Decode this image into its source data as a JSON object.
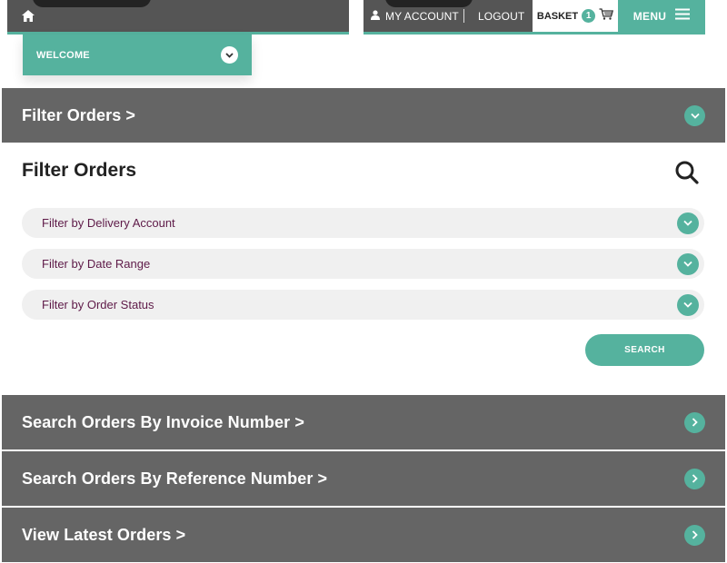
{
  "topnav": {
    "my_account": "MY ACCOUNT",
    "logout": "LOGOUT",
    "basket_label": "BASKET",
    "basket_count": "1",
    "menu_label": "MENU"
  },
  "welcome": {
    "label": "WELCOME"
  },
  "sections": {
    "filter_orders_bar": "Filter Orders >",
    "invoice_bar": "Search Orders By Invoice Number >",
    "reference_bar": "Search Orders By Reference Number >",
    "latest_bar": "View Latest Orders >"
  },
  "filter_panel": {
    "title": "Filter Orders",
    "rows": [
      {
        "label": "Filter by Delivery Account"
      },
      {
        "label": "Filter by Date Range"
      },
      {
        "label": "Filter by Order Status"
      }
    ],
    "search_button": "SEARCH"
  },
  "colors": {
    "accent": "#55b29e",
    "bar_gray": "#656565",
    "nav_gray": "#555555",
    "filter_text": "#5e1a48"
  },
  "icons": [
    "home-icon",
    "user-icon",
    "cart-icon",
    "hamburger-icon",
    "chevron-down-icon",
    "chevron-right-icon",
    "search-icon"
  ]
}
